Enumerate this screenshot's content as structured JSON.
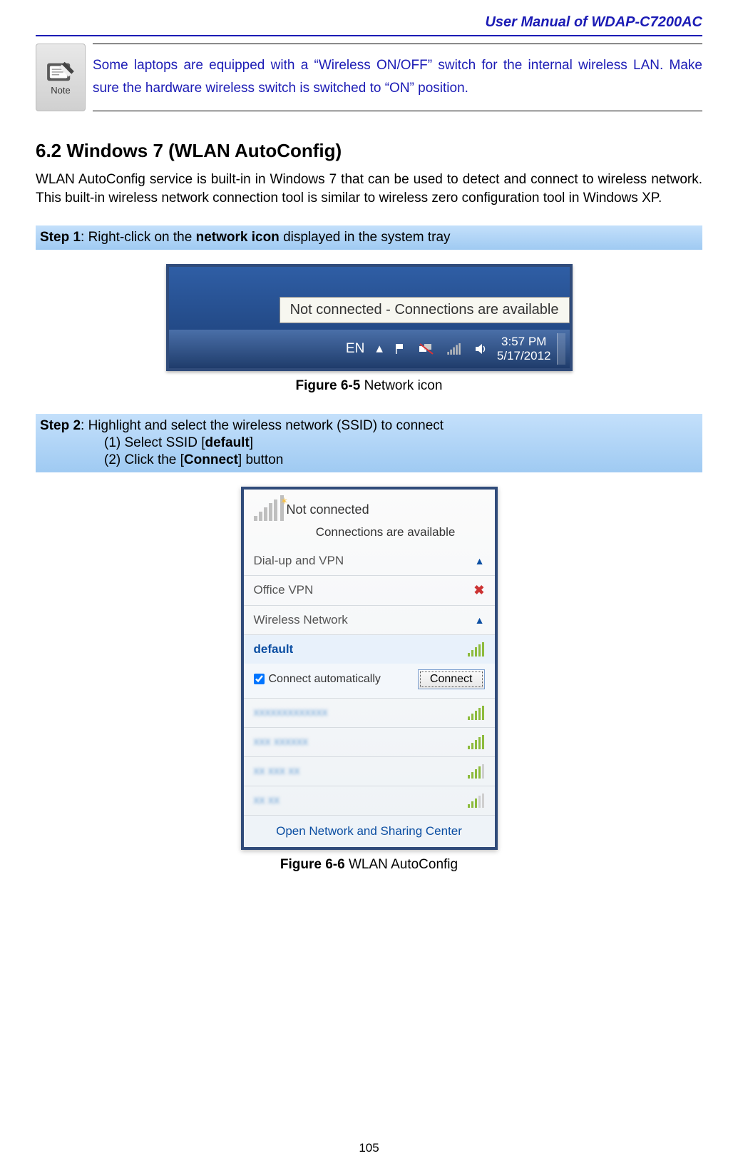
{
  "header": {
    "title": "User Manual of WDAP-C7200AC"
  },
  "note": {
    "icon_label": "Note",
    "text": "Some laptops are equipped with a “Wireless ON/OFF” switch for the internal wireless LAN. Make sure the hardware wireless switch is switched to “ON” position."
  },
  "section": {
    "heading": "6.2  Windows 7 (WLAN AutoConfig)",
    "intro": "WLAN AutoConfig service is built-in in Windows 7 that can be used to detect and connect to wireless network. This built-in wireless network connection tool is similar to wireless zero configuration tool in Windows XP."
  },
  "step1": {
    "prefix": "Step 1",
    "text_a": ": Right-click on the ",
    "bold_a": "network icon",
    "text_b": " displayed in the system tray"
  },
  "fig65": {
    "tooltip": "Not connected - Connections are available",
    "lang": "EN",
    "time": "3:57 PM",
    "date": "5/17/2012",
    "caption_bold": "Figure 6-5",
    "caption_rest": " Network icon"
  },
  "step2": {
    "prefix": "Step 2",
    "text_a": ": Highlight and select the wireless network (SSID) to connect",
    "sub1_a": "(1)  Select SSID [",
    "sub1_bold": "default",
    "sub1_b": "]",
    "sub2_a": "(2)  Click the [",
    "sub2_bold": "Connect",
    "sub2_b": "] button"
  },
  "fig66": {
    "not_connected": "Not connected",
    "avail": "Connections are available",
    "dialup": "Dial-up and VPN",
    "office_vpn": "Office VPN",
    "wireless_cat": "Wireless Network",
    "selected_ssid": "default",
    "auto_label": "Connect automatically",
    "connect_btn": "Connect",
    "footer": "Open Network and Sharing Center",
    "blurred_rows": [
      "xxxxxxxxxxxxx",
      "xxx xxxxxx",
      "xx xxx xx",
      "xx xx"
    ],
    "caption_bold": "Figure 6-6",
    "caption_rest": " WLAN AutoConfig"
  },
  "page_number": "105"
}
